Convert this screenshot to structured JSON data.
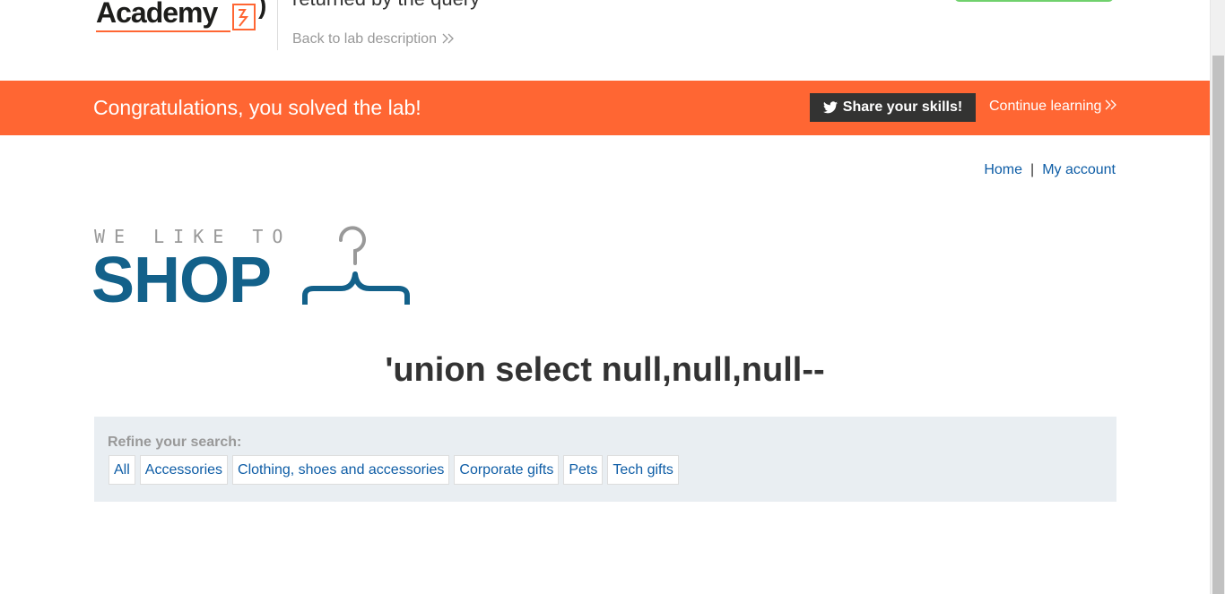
{
  "lab_header": {
    "academy_word": "Academy",
    "lab_title": "returned by the query",
    "back_link": "Back to lab description",
    "back_link_chevron": "»"
  },
  "banner": {
    "message": "Congratulations, you solved the lab!",
    "share_button": "Share your skills!",
    "continue_link": "Continue learning",
    "continue_chevron": "»",
    "brand_color": "#ff6633"
  },
  "nav": {
    "home": "Home",
    "separator": "|",
    "my_account": "My account"
  },
  "shop_logo": {
    "tagline": "WE LIKE TO",
    "word": "SHOP",
    "icon": "hanger-icon",
    "color": "#13618a"
  },
  "search_heading": "'union select null,null,null--",
  "filter": {
    "label": "Refine your search:",
    "categories": [
      "All",
      "Accessories",
      "Clothing, shoes and accessories",
      "Corporate gifts",
      "Pets",
      "Tech gifts"
    ]
  }
}
